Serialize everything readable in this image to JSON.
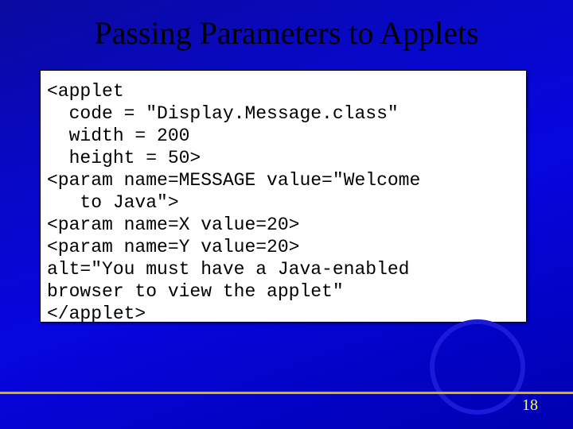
{
  "slide": {
    "title": "Passing Parameters to Applets",
    "code": "<applet\n  code = \"Display.Message.class\"\n  width = 200\n  height = 50>\n<param name=MESSAGE value=\"Welcome\n   to Java\">\n<param name=X value=20>\n<param name=Y value=20>\nalt=\"You must have a Java-enabled\nbrowser to view the applet\"\n</applet>",
    "page_number": "18"
  }
}
